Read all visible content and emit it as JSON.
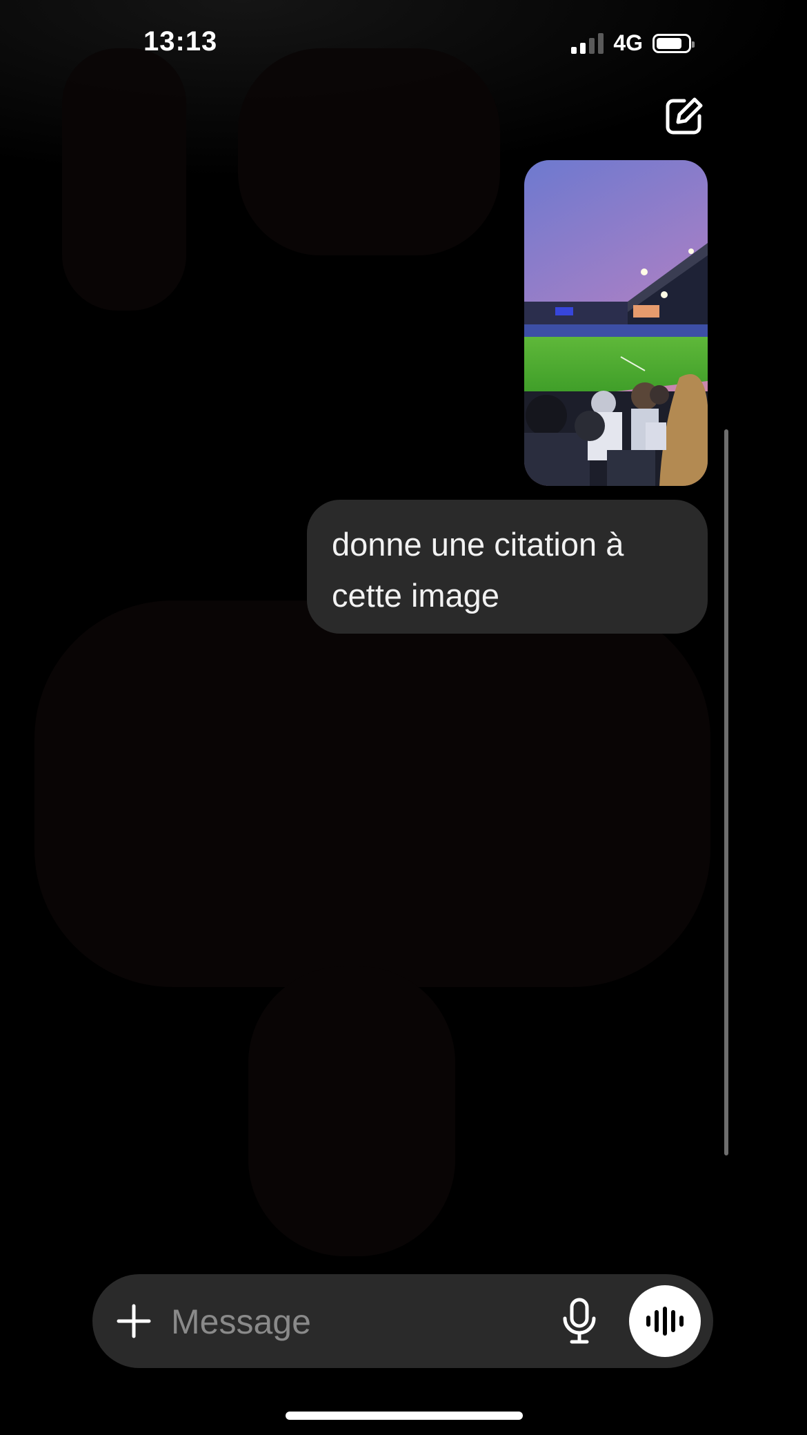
{
  "status_bar": {
    "time": "13:13",
    "network": "4G",
    "signal_bars_active": 2,
    "signal_bars_total": 4,
    "battery_level": 0.82
  },
  "header": {
    "edit_icon": "compose-icon"
  },
  "conversation": {
    "attachment": {
      "kind": "photo",
      "subject": "football stadium at sunset"
    },
    "user_message": "donne une citation à cette image"
  },
  "composer": {
    "placeholder": "Message",
    "value": "",
    "plus_icon": "plus-icon",
    "mic_icon": "microphone-icon",
    "voice_icon": "voice-waveform-icon"
  },
  "colors": {
    "background": "#000000",
    "bubble": "#2a2a2a",
    "composer": "#2a2a2a",
    "placeholder": "#8a8a8a",
    "accent_button": "#ffffff"
  }
}
